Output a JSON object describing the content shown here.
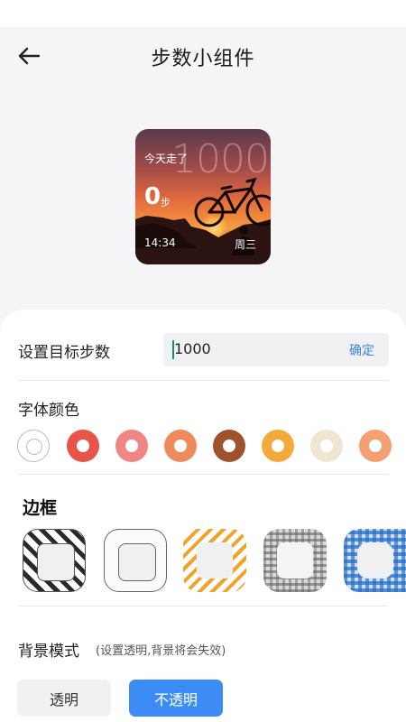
{
  "header": {
    "title": "步数小组件",
    "back_icon": "arrow-left-icon"
  },
  "widget_preview": {
    "goal_watermark": "1000",
    "today_label": "今天走了",
    "steps_value": "0",
    "steps_unit": "步",
    "time": "14:34",
    "weekday": "周三"
  },
  "goal": {
    "label": "设置目标步数",
    "value": "1000",
    "confirm_label": "确定"
  },
  "font_color": {
    "label": "字体颜色",
    "swatches": [
      "#ffffff",
      "#e8534a",
      "#f08585",
      "#ef8b5a",
      "#a0522d",
      "#f4a93a",
      "#efe6d2",
      "#f5a073"
    ]
  },
  "frame": {
    "label": "边框",
    "options": [
      "frame-diagonal-stripes",
      "frame-plain-outline",
      "frame-orange-stripes",
      "frame-gray-plaid",
      "frame-blue-gingham"
    ]
  },
  "background_mode": {
    "label": "背景模式",
    "note": "(设置透明,背景将会失效)",
    "transparent_label": "透明",
    "opaque_label": "不透明",
    "selected": "不透明"
  }
}
